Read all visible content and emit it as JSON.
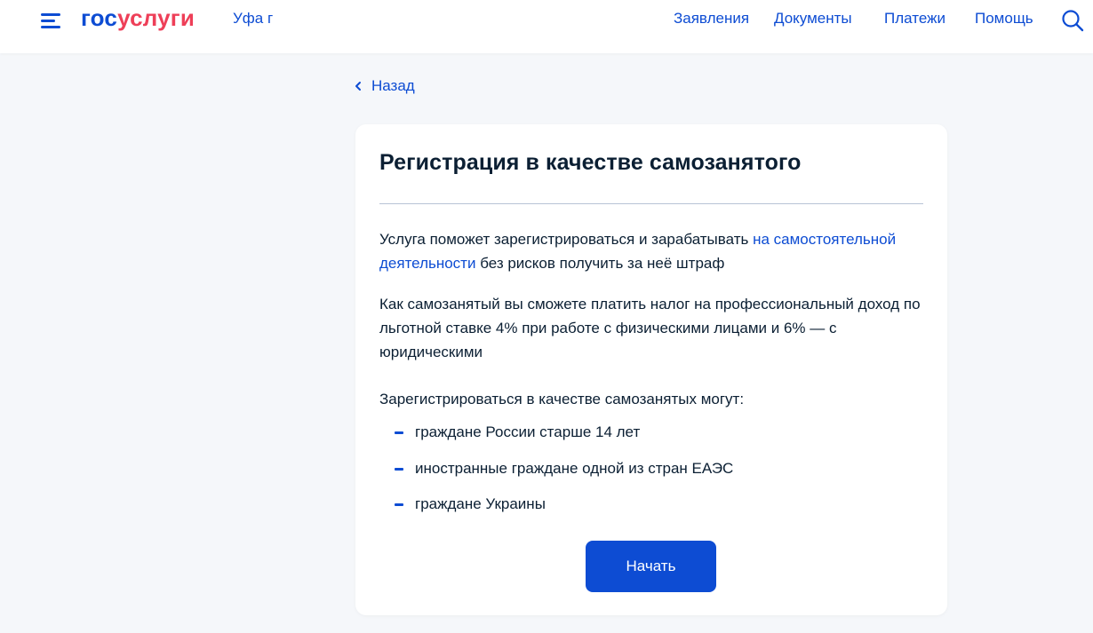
{
  "header": {
    "logo_part1": "гос",
    "logo_part2": "услуги",
    "city": "Уфа г",
    "nav": [
      {
        "label": "Заявления"
      },
      {
        "label": "Документы"
      },
      {
        "label": "Платежи"
      },
      {
        "label": "Помощь"
      }
    ],
    "icons": {
      "menu": "burger-menu-icon",
      "search": "search-icon"
    }
  },
  "back": {
    "label": "Назад",
    "icon": "chevron-left-icon"
  },
  "card": {
    "title": "Регистрация в качестве самозанятого",
    "intro_before": "Услуга поможет зарегистрироваться и зарабатывать ",
    "intro_link": "на самостоятельной деятельности",
    "intro_after": " без рисков получить за неё штраф",
    "tax_text": "Как самозанятый вы сможете платить налог на профессиональный доход по льготной ставке 4% при работе с физическими лицами и 6% — с юридическими",
    "list_heading": "Зарегистрироваться в качестве самозанятых могут:",
    "eligible": [
      "граждане России старше 14 лет",
      "иностранные граждане одной из стран ЕАЭС",
      "граждане Украины"
    ],
    "start_button": "Начать"
  },
  "colors": {
    "primary": "#0d4cd3",
    "brand_red": "#ee3f58",
    "text": "#0b1f33",
    "background": "#f5f7fa",
    "divider": "#b8c3d6"
  }
}
